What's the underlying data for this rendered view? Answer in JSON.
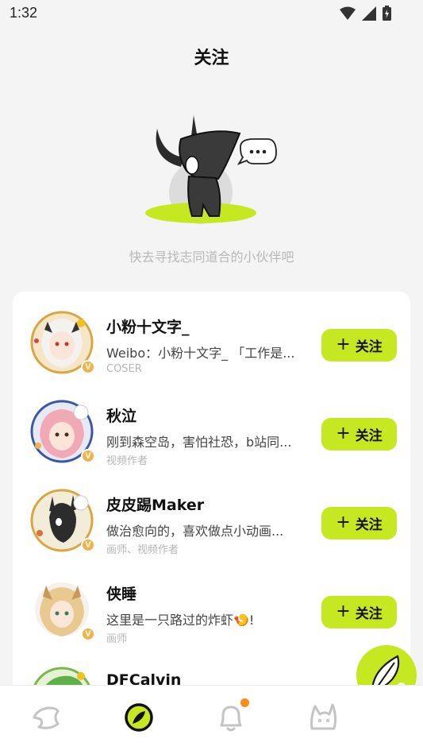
{
  "status_bar": {
    "time": "1:32"
  },
  "header": {
    "title": "关注"
  },
  "empty_state": {
    "hint": "快去寻找志同道合的小伙伴吧"
  },
  "users": [
    {
      "name": "小粉十文字_",
      "bio": "Weibo：小粉十文字_ 「工作是...",
      "tag": "COSER",
      "follow_label": "关注"
    },
    {
      "name": "秋泣",
      "bio": "刚到森空岛，害怕社恐，b站同...",
      "tag": "视频作者",
      "follow_label": "关注"
    },
    {
      "name": "皮皮踢Maker",
      "bio": "做治愈向的，喜欢做点小动画...",
      "tag": "画师、视频作者",
      "follow_label": "关注"
    },
    {
      "name": "侠睡",
      "bio": "这里是一只路过的炸虾🍤!",
      "tag": "画师",
      "follow_label": "关注"
    },
    {
      "name": "DFCalvin",
      "bio": "",
      "tag": "",
      "follow_label": ""
    }
  ],
  "fab": {
    "icon": "quill-icon"
  },
  "bottom_nav": [
    {
      "icon": "home-icon",
      "active": false
    },
    {
      "icon": "discover-icon",
      "active": true
    },
    {
      "icon": "bell-icon",
      "active": false,
      "badge": true
    },
    {
      "icon": "profile-icon",
      "active": false
    }
  ],
  "colors": {
    "accent": "#c6e820",
    "badge": "#ff8a1c",
    "background": "#f4f4f4"
  }
}
